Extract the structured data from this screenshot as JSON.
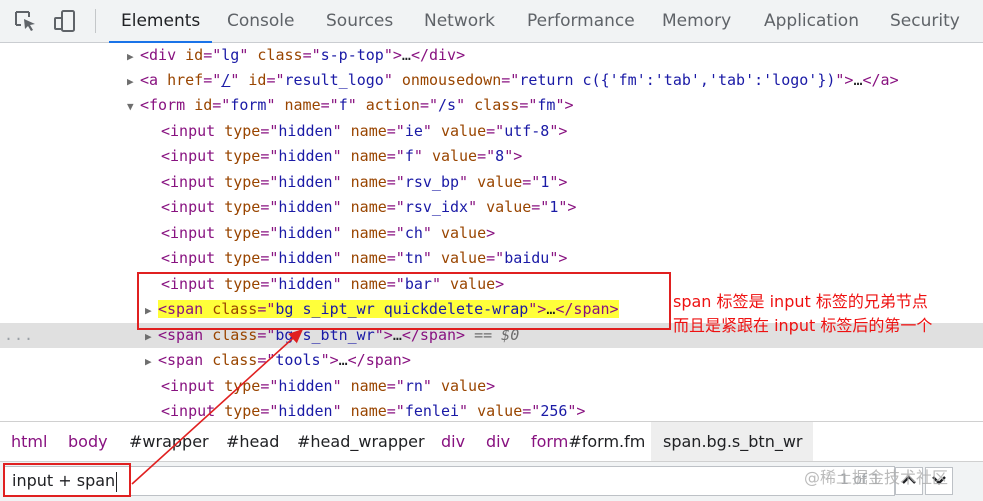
{
  "tabs": [
    "Elements",
    "Console",
    "Sources",
    "Network",
    "Performance",
    "Memory",
    "Application",
    "Security"
  ],
  "active_tab": "Elements",
  "tree": [
    [
      [
        "t",
        "<div "
      ],
      [
        "a",
        "id"
      ],
      [
        "p",
        "=\""
      ],
      [
        "v",
        "lg"
      ],
      [
        "p",
        "\" "
      ],
      [
        "a",
        "class"
      ],
      [
        "p",
        "=\""
      ],
      [
        "v",
        "s-p-top"
      ],
      [
        "p",
        "\">"
      ],
      [
        "x",
        "…"
      ],
      [
        "t",
        "</div>"
      ]
    ],
    [
      [
        "t",
        "<a "
      ],
      [
        "a",
        "href"
      ],
      [
        "p",
        "=\""
      ],
      [
        "u",
        "/"
      ],
      [
        "p",
        "\" "
      ],
      [
        "a",
        "id"
      ],
      [
        "p",
        "=\""
      ],
      [
        "v",
        "result_logo"
      ],
      [
        "p",
        "\" "
      ],
      [
        "a",
        "onmousedown"
      ],
      [
        "p",
        "=\""
      ],
      [
        "v",
        "return c({'fm':'tab','tab':'logo'})"
      ],
      [
        "p",
        "\">"
      ],
      [
        "x",
        "…"
      ],
      [
        "t",
        "</a>"
      ]
    ],
    [
      [
        "t",
        "<form "
      ],
      [
        "a",
        "id"
      ],
      [
        "p",
        "=\""
      ],
      [
        "v",
        "form"
      ],
      [
        "p",
        "\" "
      ],
      [
        "a",
        "name"
      ],
      [
        "p",
        "=\""
      ],
      [
        "v",
        "f"
      ],
      [
        "p",
        "\" "
      ],
      [
        "a",
        "action"
      ],
      [
        "p",
        "=\""
      ],
      [
        "v",
        "/s"
      ],
      [
        "p",
        "\" "
      ],
      [
        "a",
        "class"
      ],
      [
        "p",
        "=\""
      ],
      [
        "v",
        "fm"
      ],
      [
        "p",
        "\">"
      ]
    ],
    [
      [
        "t",
        "<input "
      ],
      [
        "a",
        "type"
      ],
      [
        "p",
        "=\""
      ],
      [
        "v",
        "hidden"
      ],
      [
        "p",
        "\" "
      ],
      [
        "a",
        "name"
      ],
      [
        "p",
        "=\""
      ],
      [
        "v",
        "ie"
      ],
      [
        "p",
        "\" "
      ],
      [
        "a",
        "value"
      ],
      [
        "p",
        "=\""
      ],
      [
        "v",
        "utf-8"
      ],
      [
        "p",
        "\">"
      ]
    ],
    [
      [
        "t",
        "<input "
      ],
      [
        "a",
        "type"
      ],
      [
        "p",
        "=\""
      ],
      [
        "v",
        "hidden"
      ],
      [
        "p",
        "\" "
      ],
      [
        "a",
        "name"
      ],
      [
        "p",
        "=\""
      ],
      [
        "v",
        "f"
      ],
      [
        "p",
        "\" "
      ],
      [
        "a",
        "value"
      ],
      [
        "p",
        "=\""
      ],
      [
        "v",
        "8"
      ],
      [
        "p",
        "\">"
      ]
    ],
    [
      [
        "t",
        "<input "
      ],
      [
        "a",
        "type"
      ],
      [
        "p",
        "=\""
      ],
      [
        "v",
        "hidden"
      ],
      [
        "p",
        "\" "
      ],
      [
        "a",
        "name"
      ],
      [
        "p",
        "=\""
      ],
      [
        "v",
        "rsv_bp"
      ],
      [
        "p",
        "\" "
      ],
      [
        "a",
        "value"
      ],
      [
        "p",
        "=\""
      ],
      [
        "v",
        "1"
      ],
      [
        "p",
        "\">"
      ]
    ],
    [
      [
        "t",
        "<input "
      ],
      [
        "a",
        "type"
      ],
      [
        "p",
        "=\""
      ],
      [
        "v",
        "hidden"
      ],
      [
        "p",
        "\" "
      ],
      [
        "a",
        "name"
      ],
      [
        "p",
        "=\""
      ],
      [
        "v",
        "rsv_idx"
      ],
      [
        "p",
        "\" "
      ],
      [
        "a",
        "value"
      ],
      [
        "p",
        "=\""
      ],
      [
        "v",
        "1"
      ],
      [
        "p",
        "\">"
      ]
    ],
    [
      [
        "t",
        "<input "
      ],
      [
        "a",
        "type"
      ],
      [
        "p",
        "=\""
      ],
      [
        "v",
        "hidden"
      ],
      [
        "p",
        "\" "
      ],
      [
        "a",
        "name"
      ],
      [
        "p",
        "=\""
      ],
      [
        "v",
        "ch"
      ],
      [
        "p",
        "\" "
      ],
      [
        "a",
        "value"
      ],
      [
        "p",
        ">"
      ]
    ],
    [
      [
        "t",
        "<input "
      ],
      [
        "a",
        "type"
      ],
      [
        "p",
        "=\""
      ],
      [
        "v",
        "hidden"
      ],
      [
        "p",
        "\" "
      ],
      [
        "a",
        "name"
      ],
      [
        "p",
        "=\""
      ],
      [
        "v",
        "tn"
      ],
      [
        "p",
        "\" "
      ],
      [
        "a",
        "value"
      ],
      [
        "p",
        "=\""
      ],
      [
        "v",
        "baidu"
      ],
      [
        "p",
        "\">"
      ]
    ],
    [
      [
        "t",
        "<input "
      ],
      [
        "a",
        "type"
      ],
      [
        "p",
        "=\""
      ],
      [
        "v",
        "hidden"
      ],
      [
        "p",
        "\" "
      ],
      [
        "a",
        "name"
      ],
      [
        "p",
        "=\""
      ],
      [
        "v",
        "bar"
      ],
      [
        "p",
        "\" "
      ],
      [
        "a",
        "value"
      ],
      [
        "p",
        ">"
      ]
    ],
    [
      [
        "t",
        "<span "
      ],
      [
        "a",
        "class"
      ],
      [
        "p",
        "=\""
      ],
      [
        "v",
        "bg s_ipt_wr quickdelete-wrap"
      ],
      [
        "p",
        "\">"
      ],
      [
        "x",
        "…"
      ],
      [
        "t",
        "</span>"
      ]
    ],
    [
      [
        "t",
        "<span "
      ],
      [
        "a",
        "class"
      ],
      [
        "p",
        "=\""
      ],
      [
        "v",
        "bg s_btn_wr"
      ],
      [
        "p",
        "\">"
      ],
      [
        "x",
        "…"
      ],
      [
        "t",
        "</span>"
      ],
      [
        "dl",
        " == $0"
      ]
    ],
    [
      [
        "t",
        "<span "
      ],
      [
        "a",
        "class"
      ],
      [
        "p",
        "=\""
      ],
      [
        "v",
        "tools"
      ],
      [
        "p",
        "\">"
      ],
      [
        "x",
        "…"
      ],
      [
        "t",
        "</span>"
      ]
    ],
    [
      [
        "t",
        "<input "
      ],
      [
        "a",
        "type"
      ],
      [
        "p",
        "=\""
      ],
      [
        "v",
        "hidden"
      ],
      [
        "p",
        "\" "
      ],
      [
        "a",
        "name"
      ],
      [
        "p",
        "=\""
      ],
      [
        "v",
        "rn"
      ],
      [
        "p",
        "\" "
      ],
      [
        "a",
        "value"
      ],
      [
        "p",
        ">"
      ]
    ],
    [
      [
        "t",
        "<input "
      ],
      [
        "a",
        "type"
      ],
      [
        "p",
        "=\""
      ],
      [
        "v",
        "hidden"
      ],
      [
        "p",
        "\" "
      ],
      [
        "a",
        "name"
      ],
      [
        "p",
        "=\""
      ],
      [
        "v",
        "fenlei"
      ],
      [
        "p",
        "\" "
      ],
      [
        "a",
        "value"
      ],
      [
        "p",
        "=\""
      ],
      [
        "v",
        "256"
      ],
      [
        "p",
        "\">"
      ]
    ]
  ],
  "selected_gutter": "...",
  "annotation": {
    "line1": "span 标签是 input 标签的兄弟节点",
    "line2": "而且是紧跟在 input 标签后的第一个"
  },
  "breadcrumbs": [
    [
      [
        "t",
        "html"
      ]
    ],
    [
      [
        "t",
        "body"
      ]
    ],
    [
      [
        "h",
        "#wrapper"
      ]
    ],
    [
      [
        "h",
        "#head"
      ]
    ],
    [
      [
        "h",
        "#head_wrapper"
      ]
    ],
    [
      [
        "t",
        "div"
      ]
    ],
    [
      [
        "t",
        "div"
      ]
    ],
    [
      [
        "t",
        "form"
      ],
      [
        "h",
        "#form.fm"
      ]
    ],
    [
      [
        "t",
        "span.bg.s_btn_wr"
      ]
    ]
  ],
  "search": {
    "value": "input + span",
    "match": "1 of 1"
  },
  "watermark": "@稀土掘金技术社区"
}
